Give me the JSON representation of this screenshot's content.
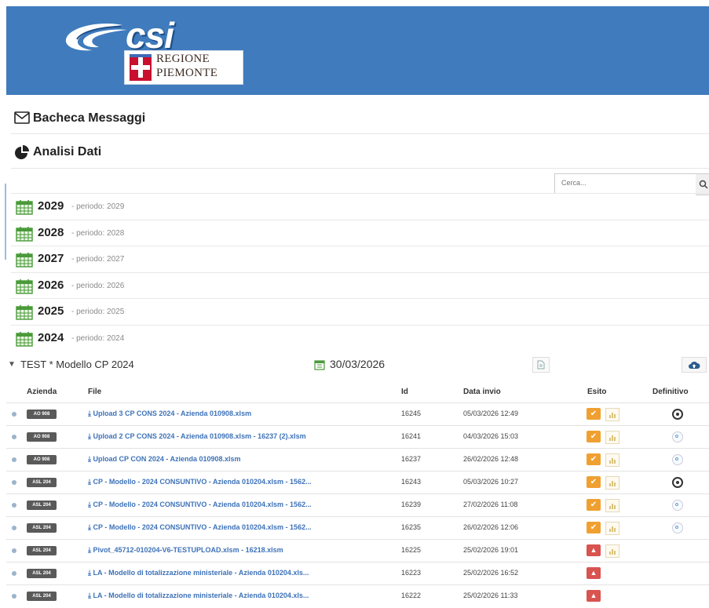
{
  "header": {
    "logo_text": "csi",
    "logo_region_line1": "REGIONE",
    "logo_region_line2": "PIEMONTE",
    "bg_color": "#3f7bbd"
  },
  "menu": {
    "messages_label": "Bacheca Messaggi",
    "analysis_label": "Analisi Dati"
  },
  "search": {
    "placeholder": "Cerca..."
  },
  "years": [
    {
      "year": "2029",
      "period": "- periodo: 2029"
    },
    {
      "year": "2028",
      "period": "- periodo: 2028"
    },
    {
      "year": "2027",
      "period": "- periodo: 2027"
    },
    {
      "year": "2026",
      "period": "- periodo: 2026"
    },
    {
      "year": "2025",
      "period": "- periodo: 2025"
    },
    {
      "year": "2024",
      "period": "- periodo: 2024"
    }
  ],
  "section": {
    "title": "TEST * Modello CP 2024",
    "date": "30/03/2026"
  },
  "table": {
    "headers": {
      "azienda": "Azienda",
      "file": "File",
      "id": "Id",
      "data": "Data invio",
      "esito": "Esito",
      "definitivo": "Definitivo"
    },
    "rows": [
      {
        "azienda": "AO 908",
        "file": "Upload 3 CP CONS 2024 - Azienda 010908.xlsm",
        "id": "16245",
        "data": "05/03/2026 12:49",
        "esito": "ok",
        "definitivo": "on"
      },
      {
        "azienda": "AO 908",
        "file": "Upload 2 CP CONS 2024 - Azienda 010908.xlsm - 16237 (2).xlsm",
        "id": "16241",
        "data": "04/03/2026 15:03",
        "esito": "ok",
        "definitivo": "off"
      },
      {
        "azienda": "AO 908",
        "file": "Upload CP CON 2024 - Azienda 010908.xlsm",
        "id": "16237",
        "data": "26/02/2026 12:48",
        "esito": "ok",
        "definitivo": "off"
      },
      {
        "azienda": "ASL 204",
        "file": "CP - Modello - 2024 CONSUNTIVO - Azienda 010204.xlsm - 1562...",
        "id": "16243",
        "data": "05/03/2026 10:27",
        "esito": "ok",
        "definitivo": "on"
      },
      {
        "azienda": "ASL 204",
        "file": "CP - Modello - 2024 CONSUNTIVO - Azienda 010204.xlsm - 1562...",
        "id": "16239",
        "data": "27/02/2026 11:08",
        "esito": "ok",
        "definitivo": "off"
      },
      {
        "azienda": "ASL 204",
        "file": "CP - Modello - 2024 CONSUNTIVO - Azienda 010204.xlsm - 1562...",
        "id": "16235",
        "data": "26/02/2026 12:06",
        "esito": "ok",
        "definitivo": "off"
      },
      {
        "azienda": "ASL 204",
        "file": "Pivot_45712-010204-V6-TESTUPLOAD.xlsm - 16218.xlsm",
        "id": "16225",
        "data": "25/02/2026 19:01",
        "esito": "err-chart",
        "definitivo": "none"
      },
      {
        "azienda": "ASL 204",
        "file": "LA - Modello di totalizzazione ministeriale - Azienda 010204.xls...",
        "id": "16223",
        "data": "25/02/2026 16:52",
        "esito": "err",
        "definitivo": "none"
      },
      {
        "azienda": "ASL 204",
        "file": "LA - Modello di totalizzazione ministeriale - Azienda 010204.xls...",
        "id": "16222",
        "data": "25/02/2026 11:33",
        "esito": "err",
        "definitivo": "none"
      }
    ]
  }
}
